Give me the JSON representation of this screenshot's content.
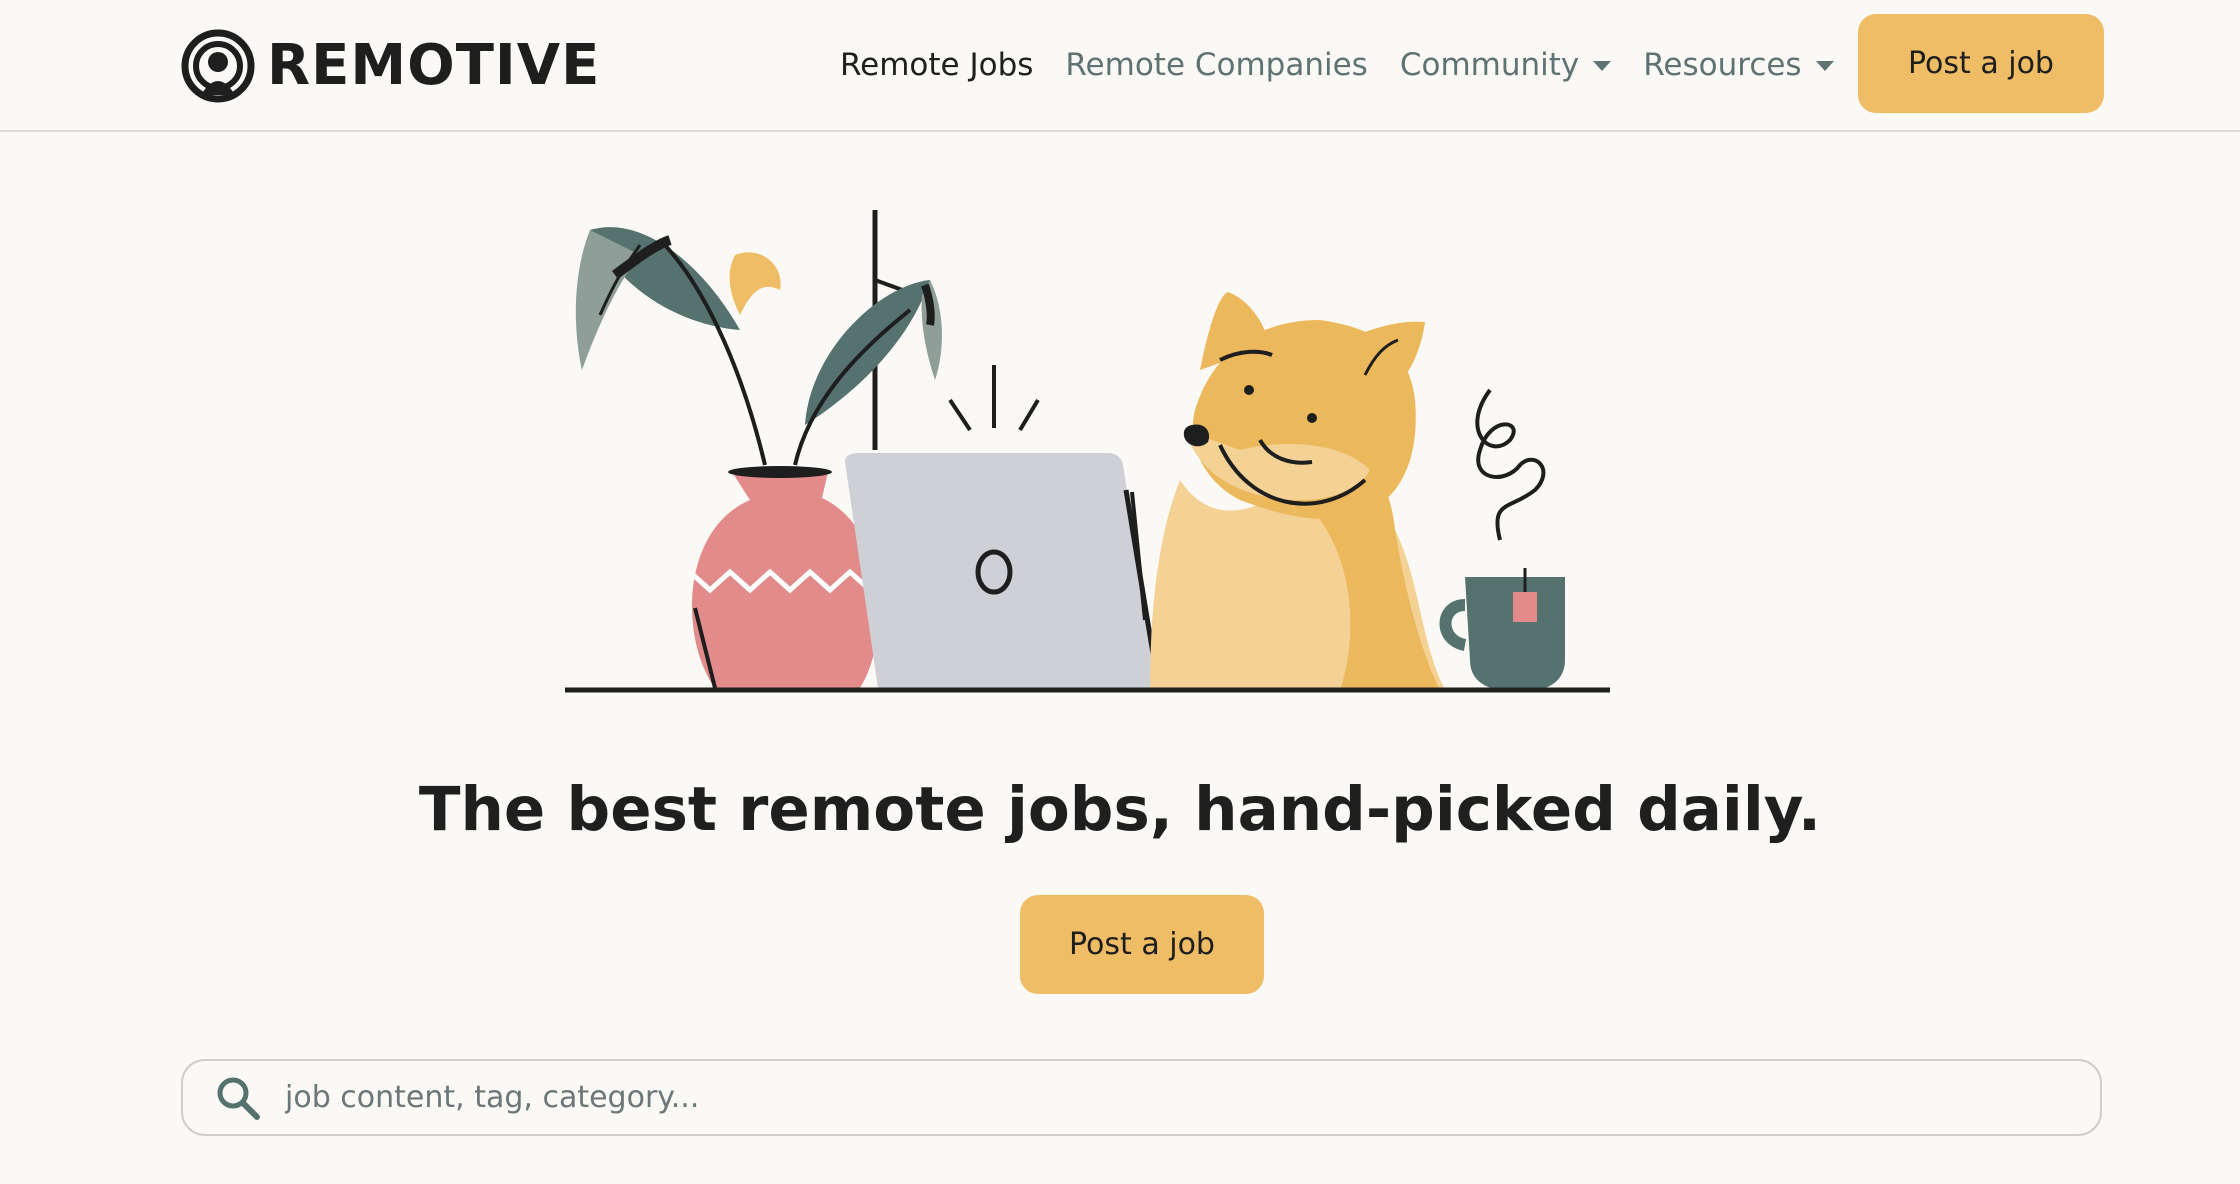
{
  "header": {
    "brand": "REMOTIVE",
    "nav": [
      {
        "label": "Remote Jobs",
        "active": true,
        "dropdown": false
      },
      {
        "label": "Remote Companies",
        "active": false,
        "dropdown": false
      },
      {
        "label": "Community",
        "active": false,
        "dropdown": true
      },
      {
        "label": "Resources",
        "active": false,
        "dropdown": true
      }
    ],
    "cta_label": "Post a job"
  },
  "hero": {
    "headline": "The best remote jobs, hand-picked daily.",
    "cta_label": "Post a job",
    "illustration": "dog-at-laptop-illustration"
  },
  "search": {
    "placeholder": "job content, tag, category...",
    "value": ""
  },
  "colors": {
    "background": "#fbf9f5",
    "accent": "#efbd66",
    "nav_text": "#5f7274",
    "text": "#1f1f1f"
  }
}
